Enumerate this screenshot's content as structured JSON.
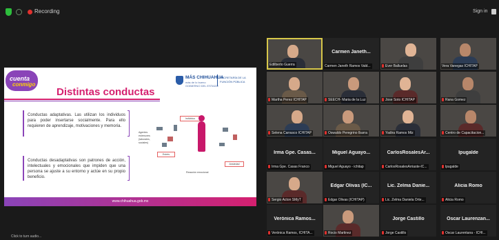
{
  "topbar": {
    "recording_label": "Recording",
    "signin_label": "Sign in",
    "shield_icon": "security-shield-icon",
    "rec_color": "#e0312e"
  },
  "slide": {
    "logo_line1": "cuenta",
    "logo_line2": "conmigo",
    "title": "Distintas conductas",
    "gov_name": "MÁS CHIHUAHUA",
    "gov_tag1": "más de lo bueno",
    "gov_tag2": "GOBIERNO DEL ESTADO",
    "gov_dept1": "SECRETARÍA DE LA",
    "gov_dept2": "FUNCIÓN PÚBLICA",
    "text_adaptive": "Conductas adaptativas. Las utilizan los individuos para poder insertarse socialmente. Para ello requieren de aprendizaje, motivaciones y memoria.",
    "text_maladaptive": "Conductas desadaptativas son patrones de acción, intelectuales y emocionales que impiden que una persona se ajuste a su entorno y actúe en su propio beneficio.",
    "diagram": {
      "individuo": "Individuo",
      "agentes": "Agentes estresores (laborales, sociales)",
      "estres": "Estrés",
      "ansiedad": "Ansiedad",
      "reaccion": "Reacción emocional"
    },
    "footer_url": "www.chihuahua.gob.mx",
    "accent_pink": "#d5206f",
    "accent_purple": "#8a44b8"
  },
  "gallery": {
    "tiles": [
      {
        "label": "Edilberto Guerra",
        "name": "",
        "muted": false,
        "cam": true,
        "active": true
      },
      {
        "label": "Carmen Janeth Ramos Vald...",
        "name": "Carmen Janeth...",
        "muted": false,
        "cam": false
      },
      {
        "label": "Ever Balluelas",
        "name": "",
        "muted": true,
        "cam": true
      },
      {
        "label": "Vera Vanegas ICHITAP",
        "name": "",
        "muted": false,
        "cam": true
      },
      {
        "label": "Martha Perez ICHITAP",
        "name": "",
        "muted": true,
        "cam": true
      },
      {
        "label": "SEECH- Maria de la Luz",
        "name": "",
        "muted": true,
        "cam": true
      },
      {
        "label": "Jose Soto ICHITAP",
        "name": "",
        "muted": true,
        "cam": true
      },
      {
        "label": "Rana Gomez",
        "name": "",
        "muted": true,
        "cam": true
      },
      {
        "label": "Selena Carrasco ICHITAP",
        "name": "",
        "muted": true,
        "cam": true
      },
      {
        "label": "Oswaldo Peregrino Ibarra",
        "name": "",
        "muted": true,
        "cam": true
      },
      {
        "label": "Yadira Ramos Mtz",
        "name": "",
        "muted": true,
        "cam": true
      },
      {
        "label": "Centro de Capacitacion...",
        "name": "",
        "muted": true,
        "cam": true
      },
      {
        "label": "Irma Gpe. Casas Franco",
        "name": "Irma Gpe. Casas...",
        "muted": true,
        "cam": false
      },
      {
        "label": "Miguel Aguayo - ichitap",
        "name": "Miguel Aguayo...",
        "muted": true,
        "cam": false
      },
      {
        "label": "CarlosRosalesArriaste-IC...",
        "name": "CarlosRosalesAr...",
        "muted": true,
        "cam": false
      },
      {
        "label": "lpugalde",
        "name": "lpugalde",
        "muted": true,
        "cam": false
      },
      {
        "label": "Sergio Acton SMyT",
        "name": "",
        "muted": true,
        "cam": true
      },
      {
        "label": "Edgar Olivas (ICHITAP)",
        "name": "Edgar Olivas (IC...",
        "muted": true,
        "cam": false
      },
      {
        "label": "Lic. Zelma Daniela Orte...",
        "name": "Lic. Zelma Danie...",
        "muted": true,
        "cam": false
      },
      {
        "label": "Alicia Romo",
        "name": "Alicia Romo",
        "muted": true,
        "cam": false
      },
      {
        "label": "Verónica Ramos, ICHITA...",
        "name": "Verónica Ramos...",
        "muted": true,
        "cam": false
      },
      {
        "label": "Rocio Martinez",
        "name": "",
        "muted": true,
        "cam": true
      },
      {
        "label": "Jorge Castillo",
        "name": "Jorge Castillo",
        "muted": true,
        "cam": false
      },
      {
        "label": "Oscar Laurentana - ICHI...",
        "name": "Oscar Laurenzan...",
        "muted": true,
        "cam": false
      }
    ]
  },
  "bottom_caption": "Click to turn audio..."
}
